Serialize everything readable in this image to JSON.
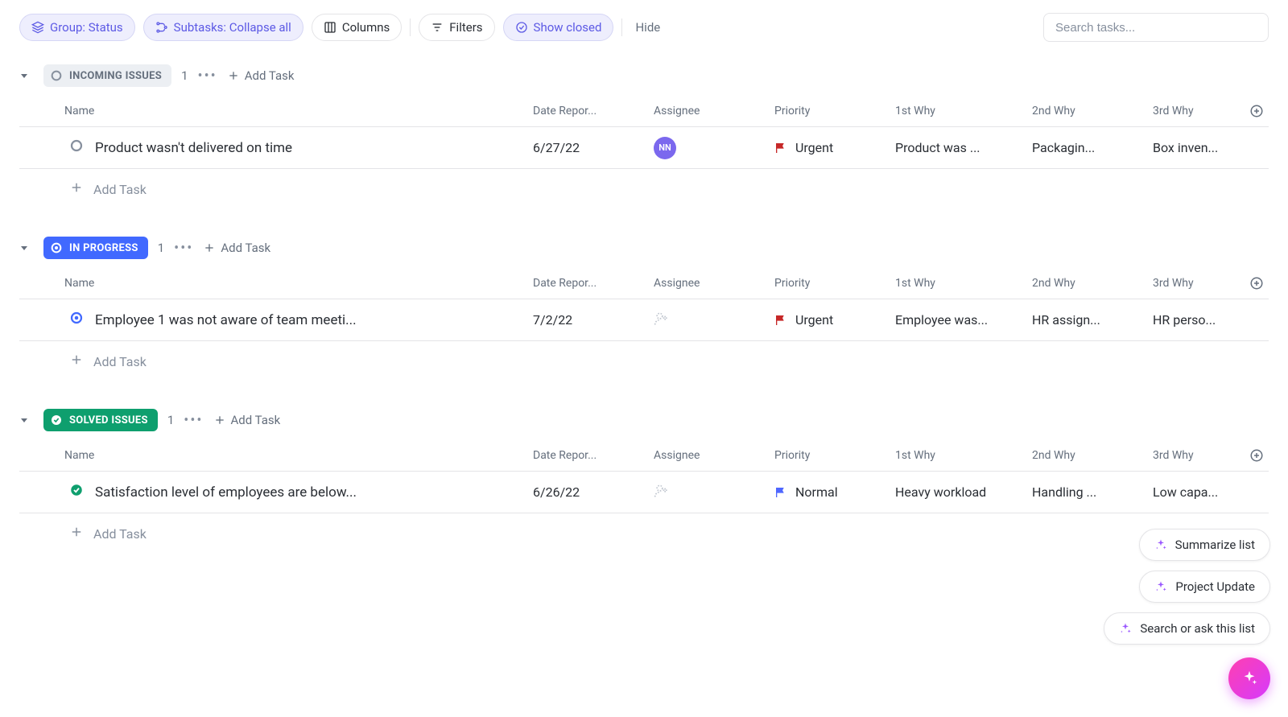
{
  "toolbar": {
    "group_label": "Group: Status",
    "subtasks_label": "Subtasks: Collapse all",
    "columns_label": "Columns",
    "filters_label": "Filters",
    "show_closed_label": "Show closed",
    "hide_label": "Hide",
    "search_placeholder": "Search tasks..."
  },
  "columns": {
    "name": "Name",
    "date": "Date Repor...",
    "assignee": "Assignee",
    "priority": "Priority",
    "why1": "1st Why",
    "why2": "2nd Why",
    "why3": "3rd Why"
  },
  "add_task_label": "Add Task",
  "add_task_row_label": "Add Task",
  "groups": {
    "incoming": {
      "name": "INCOMING ISSUES",
      "count": "1",
      "chip_bg": "#eceff3",
      "chip_fg": "#656f7d",
      "status_ring": "#87909e"
    },
    "inprogress": {
      "name": "IN PROGRESS",
      "count": "1",
      "chip_bg": "#4169ff",
      "chip_fg": "#ffffff",
      "status_ring": "#4169ff"
    },
    "solved": {
      "name": "SOLVED ISSUES",
      "count": "1",
      "chip_bg": "#0e9f6e",
      "chip_fg": "#ffffff",
      "status_ring": "#0e9f6e"
    }
  },
  "tasks": {
    "incoming": {
      "name": "Product wasn't delivered on time",
      "date": "6/27/22",
      "assignee_initials": "NN",
      "assignee_color": "#7b68ee",
      "priority_label": "Urgent",
      "priority_color": "#c62828",
      "why1": "Product was ...",
      "why2": "Packagin...",
      "why3": "Box inven..."
    },
    "inprogress": {
      "name": "Employee 1 was not aware of team meeti...",
      "date": "7/2/22",
      "assignee_initials": "",
      "priority_label": "Urgent",
      "priority_color": "#c62828",
      "why1": "Employee was...",
      "why2": "HR assign...",
      "why3": "HR perso..."
    },
    "solved": {
      "name": "Satisfaction level of employees are below...",
      "date": "6/26/22",
      "assignee_initials": "",
      "priority_label": "Normal",
      "priority_color": "#4f67ff",
      "why1": "Heavy workload",
      "why2": "Handling ...",
      "why3": "Low capa..."
    }
  },
  "ai": {
    "summarize": "Summarize list",
    "project_update": "Project Update",
    "search_ask": "Search or ask this list"
  }
}
